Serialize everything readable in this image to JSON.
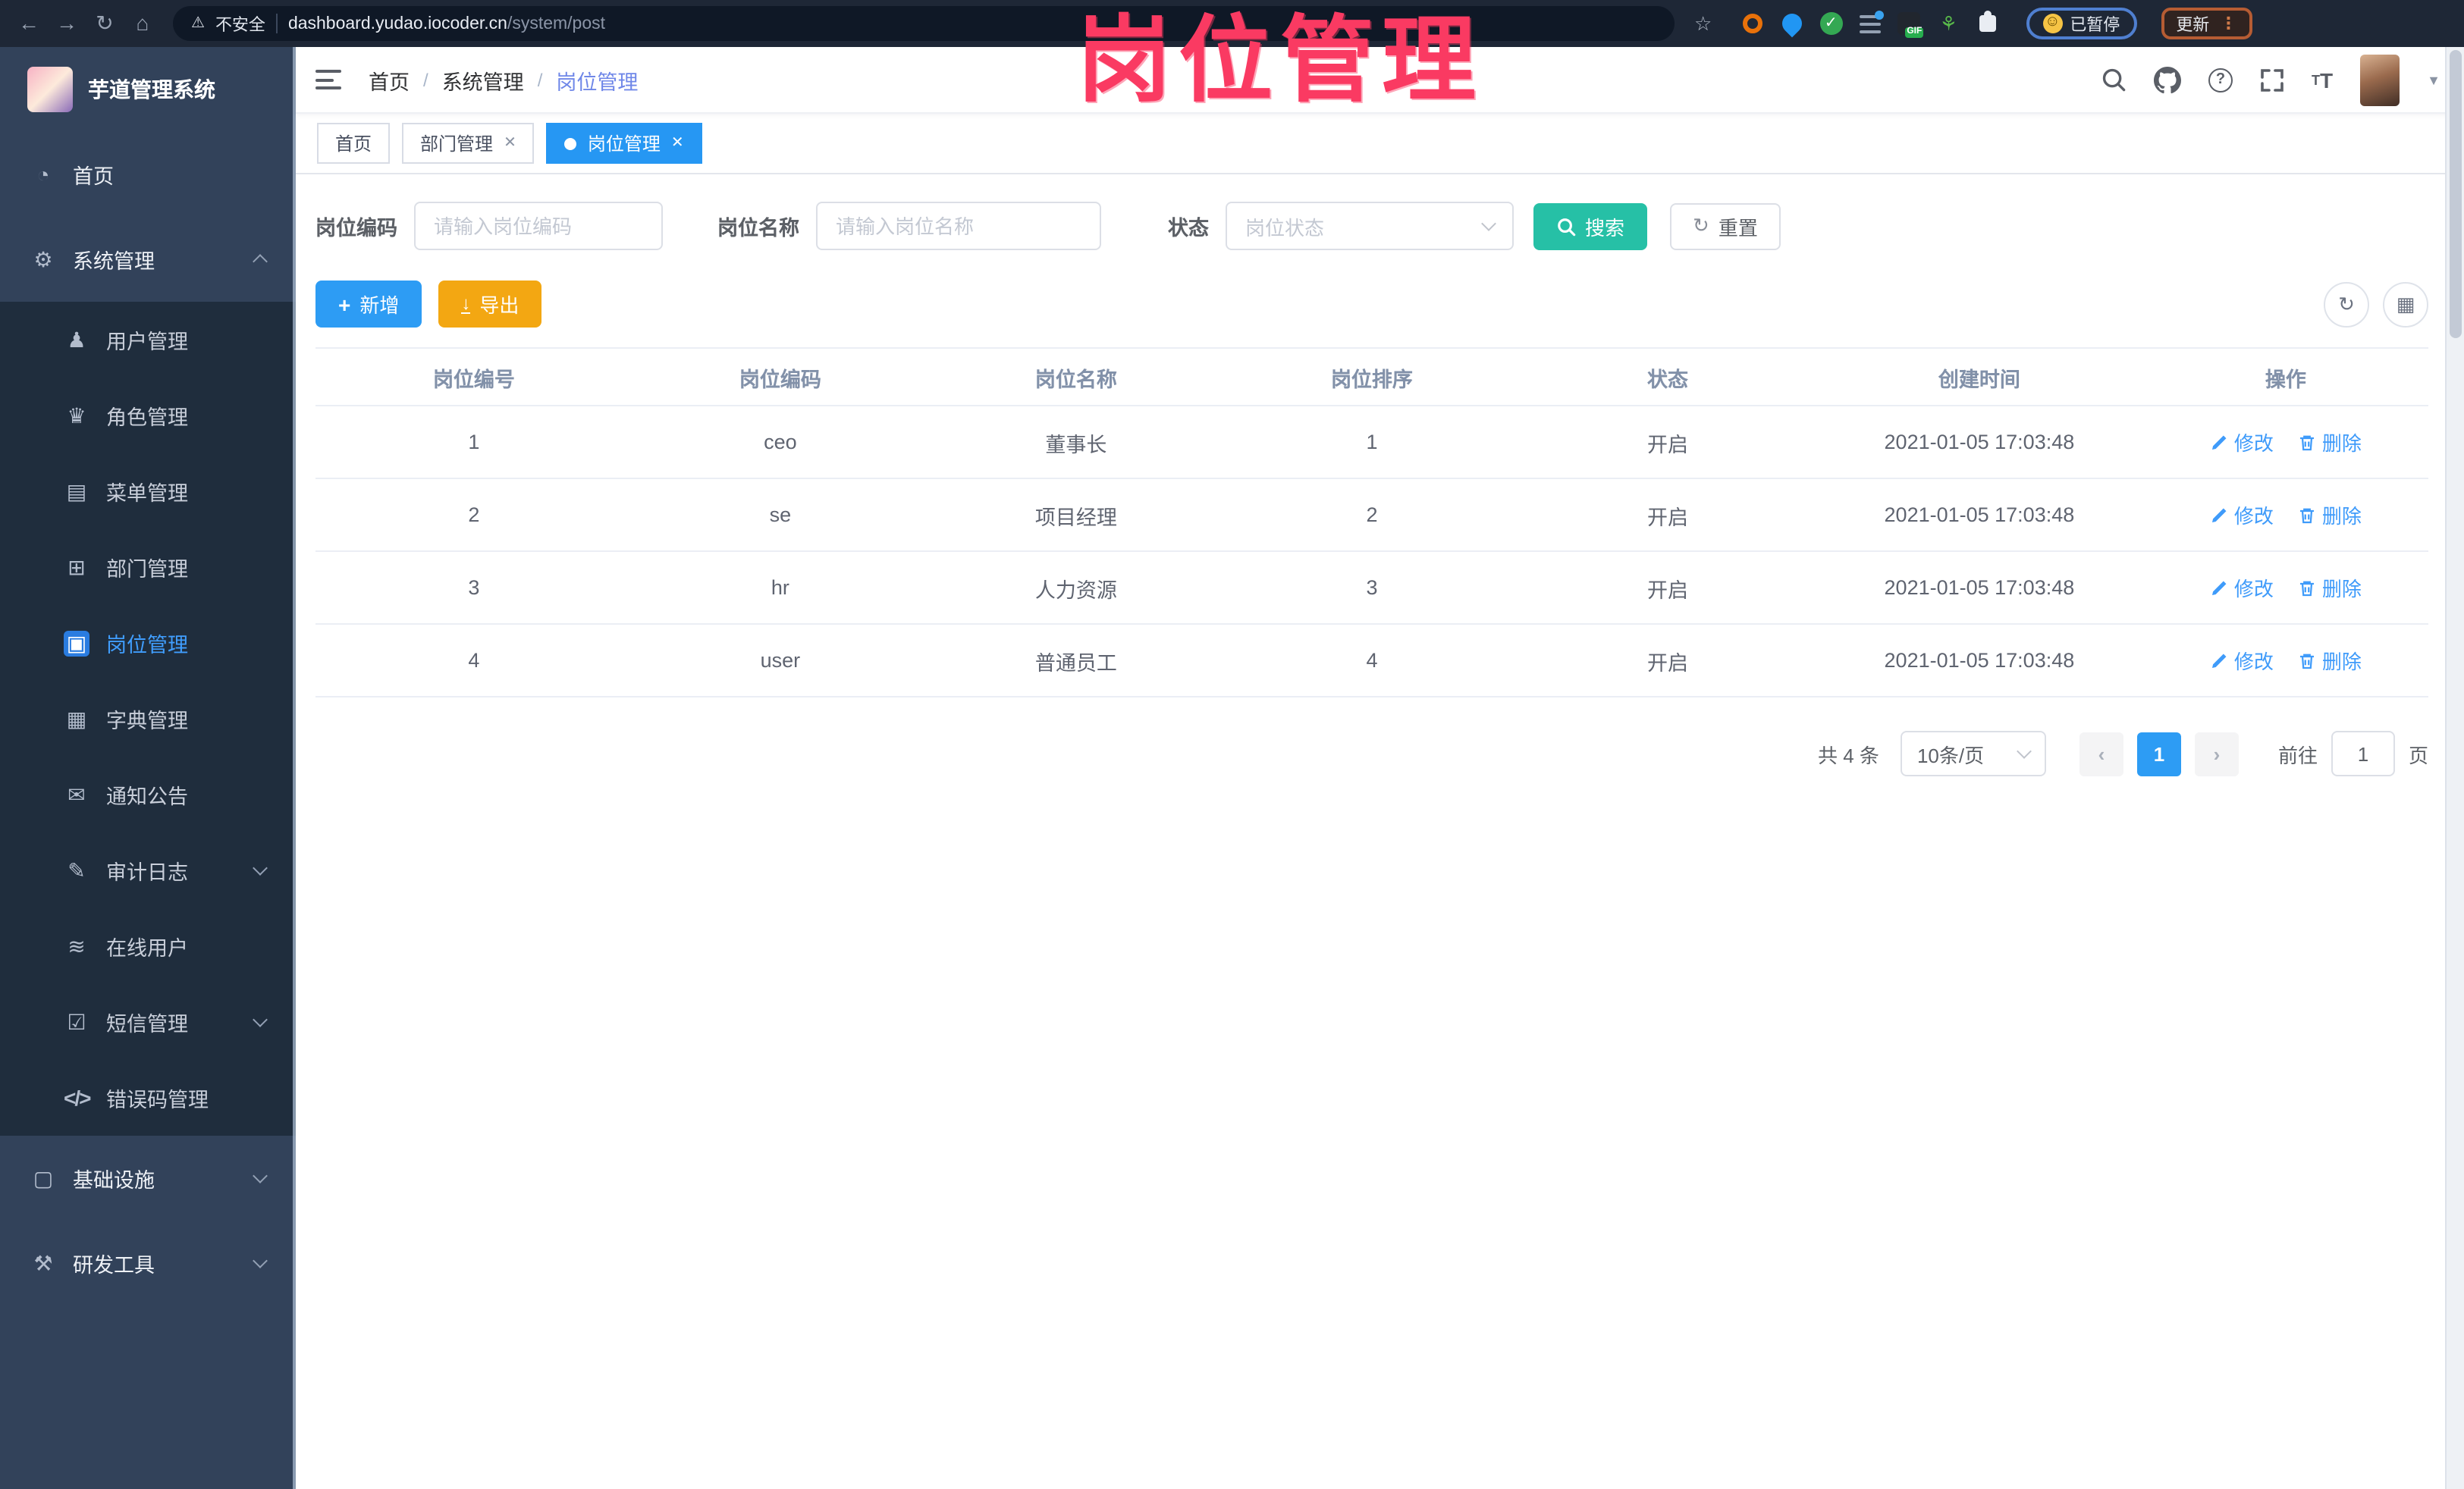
{
  "browser": {
    "security_label": "不安全",
    "url_domain": "dashboard.yudao.iocoder.cn",
    "url_path": "/system/post",
    "ext_gif_label": "GIF",
    "paused_label": "已暂停",
    "update_label": "更新"
  },
  "annotation": {
    "title": "岗位管理"
  },
  "sidebar": {
    "app_title": "芋道管理系统",
    "items": [
      {
        "label": "首页",
        "icon": "dashboard-icon",
        "level": 1
      },
      {
        "label": "系统管理",
        "icon": "gear-icon",
        "level": 1,
        "expanded": true
      },
      {
        "label": "用户管理",
        "icon": "user-icon",
        "level": 2
      },
      {
        "label": "角色管理",
        "icon": "role-icon",
        "level": 2
      },
      {
        "label": "菜单管理",
        "icon": "menu-icon",
        "level": 2
      },
      {
        "label": "部门管理",
        "icon": "department-icon",
        "level": 2
      },
      {
        "label": "岗位管理",
        "icon": "post-icon",
        "level": 2,
        "active": true
      },
      {
        "label": "字典管理",
        "icon": "dictionary-icon",
        "level": 2
      },
      {
        "label": "通知公告",
        "icon": "notice-icon",
        "level": 2
      },
      {
        "label": "审计日志",
        "icon": "audit-log-icon",
        "level": 2,
        "collapsed": true
      },
      {
        "label": "在线用户",
        "icon": "online-users-icon",
        "level": 2
      },
      {
        "label": "短信管理",
        "icon": "sms-icon",
        "level": 2,
        "collapsed": true
      },
      {
        "label": "错误码管理",
        "icon": "error-code-icon",
        "level": 2
      },
      {
        "label": "基础设施",
        "icon": "infrastructure-icon",
        "level": 1,
        "collapsed": true
      },
      {
        "label": "研发工具",
        "icon": "dev-tools-icon",
        "level": 1,
        "collapsed": true
      }
    ]
  },
  "breadcrumb": {
    "items": [
      "首页",
      "系统管理",
      "岗位管理"
    ]
  },
  "tabs": [
    {
      "label": "首页",
      "closable": false,
      "active": false
    },
    {
      "label": "部门管理",
      "closable": true,
      "active": false
    },
    {
      "label": "岗位管理",
      "closable": true,
      "active": true
    }
  ],
  "filters": {
    "code_label": "岗位编码",
    "code_placeholder": "请输入岗位编码",
    "name_label": "岗位名称",
    "name_placeholder": "请输入岗位名称",
    "status_label": "状态",
    "status_placeholder": "岗位状态",
    "search_label": "搜索",
    "reset_label": "重置"
  },
  "toolbar": {
    "add_label": "新增",
    "export_label": "导出"
  },
  "table": {
    "columns": [
      "岗位编号",
      "岗位编码",
      "岗位名称",
      "岗位排序",
      "状态",
      "创建时间",
      "操作"
    ],
    "rows": [
      {
        "id": "1",
        "code": "ceo",
        "name": "董事长",
        "sort": "1",
        "status": "开启",
        "created": "2021-01-05 17:03:48"
      },
      {
        "id": "2",
        "code": "se",
        "name": "项目经理",
        "sort": "2",
        "status": "开启",
        "created": "2021-01-05 17:03:48"
      },
      {
        "id": "3",
        "code": "hr",
        "name": "人力资源",
        "sort": "3",
        "status": "开启",
        "created": "2021-01-05 17:03:48"
      },
      {
        "id": "4",
        "code": "user",
        "name": "普通员工",
        "sort": "4",
        "status": "开启",
        "created": "2021-01-05 17:03:48"
      }
    ],
    "edit_label": "修改",
    "delete_label": "删除"
  },
  "pagination": {
    "total_label": "共 4 条",
    "page_size_label": "10条/页",
    "current_page": "1",
    "goto_label": "前往",
    "goto_value": "1",
    "page_unit_label": "页"
  },
  "colors": {
    "accent": "#409eff",
    "success": "#26c0a6",
    "warning": "#f3a712",
    "annotation": "#fa3a62"
  }
}
